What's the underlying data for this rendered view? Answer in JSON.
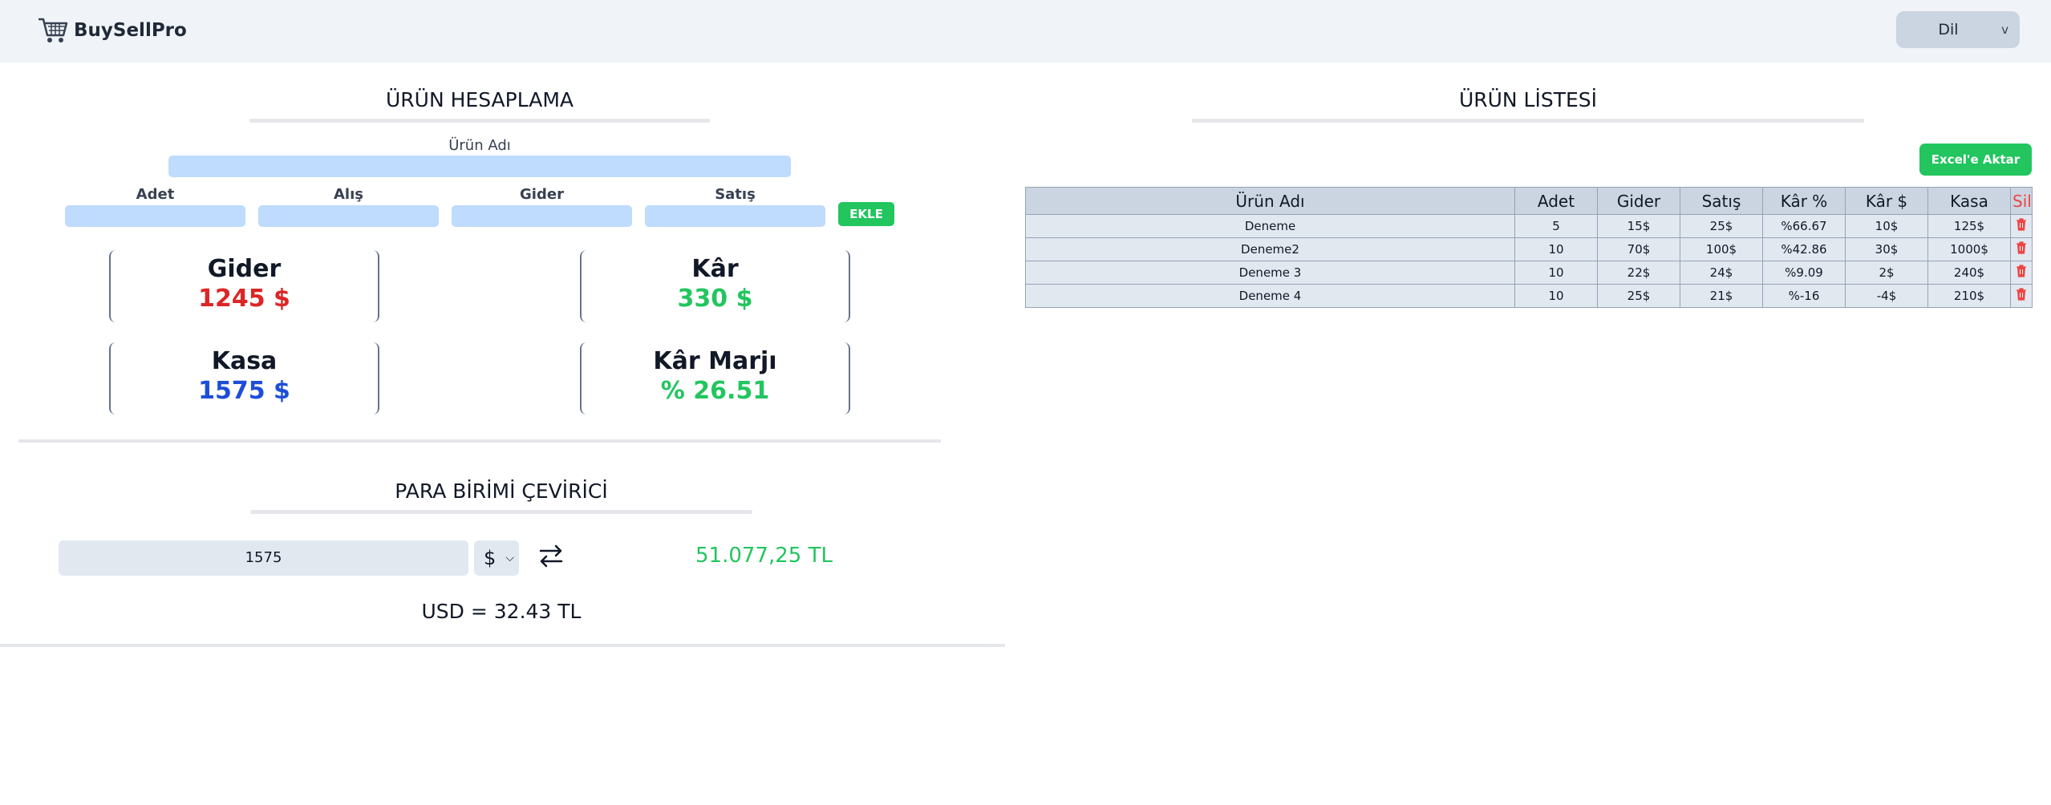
{
  "header": {
    "brand": "BuySellPro",
    "lang_label": "Dil",
    "lang_caret": "v"
  },
  "calc": {
    "title": "ÜRÜN HESAPLAMA",
    "product_name_label": "Ürün Adı",
    "fields": [
      {
        "label": "Adet"
      },
      {
        "label": "Alış"
      },
      {
        "label": "Gider"
      },
      {
        "label": "Satış"
      }
    ],
    "add_button": "EKLE",
    "cards": {
      "gider": {
        "title": "Gider",
        "value": "1245 $"
      },
      "kar": {
        "title": "Kâr",
        "value": "330 $"
      },
      "kasa": {
        "title": "Kasa",
        "value": "1575 $"
      },
      "marj": {
        "title": "Kâr Marjı",
        "value": "% 26.51"
      }
    }
  },
  "converter": {
    "title": "PARA BİRİMİ ÇEVİRİCİ",
    "amount": "1575",
    "currency": "$",
    "result": "51.077,25 TL",
    "rate": "USD = 32.43 TL"
  },
  "list": {
    "title": "ÜRÜN LİSTESİ",
    "export_button": "Excel'e Aktar",
    "columns": [
      "Ürün Adı",
      "Adet",
      "Gider",
      "Satış",
      "Kâr %",
      "Kâr $",
      "Kasa",
      "Sil"
    ],
    "rows": [
      {
        "name": "Deneme",
        "adet": "5",
        "gider": "15$",
        "satis": "25$",
        "kar_pct": "%66.67",
        "kar_usd": "10$",
        "kasa": "125$",
        "kar_positive": true
      },
      {
        "name": "Deneme2",
        "adet": "10",
        "gider": "70$",
        "satis": "100$",
        "kar_pct": "%42.86",
        "kar_usd": "30$",
        "kasa": "1000$",
        "kar_positive": true
      },
      {
        "name": "Deneme 3",
        "adet": "10",
        "gider": "22$",
        "satis": "24$",
        "kar_pct": "%9.09",
        "kar_usd": "2$",
        "kasa": "240$",
        "kar_positive": false
      },
      {
        "name": "Deneme 4",
        "adet": "10",
        "gider": "25$",
        "satis": "21$",
        "kar_pct": "%-16",
        "kar_usd": "-4$",
        "kasa": "210$",
        "kar_positive": false
      }
    ]
  },
  "colors": {
    "green": "#22c55e",
    "red": "#ef4444",
    "blue": "#1d4ed8",
    "input_blue": "#bfdbfe"
  }
}
